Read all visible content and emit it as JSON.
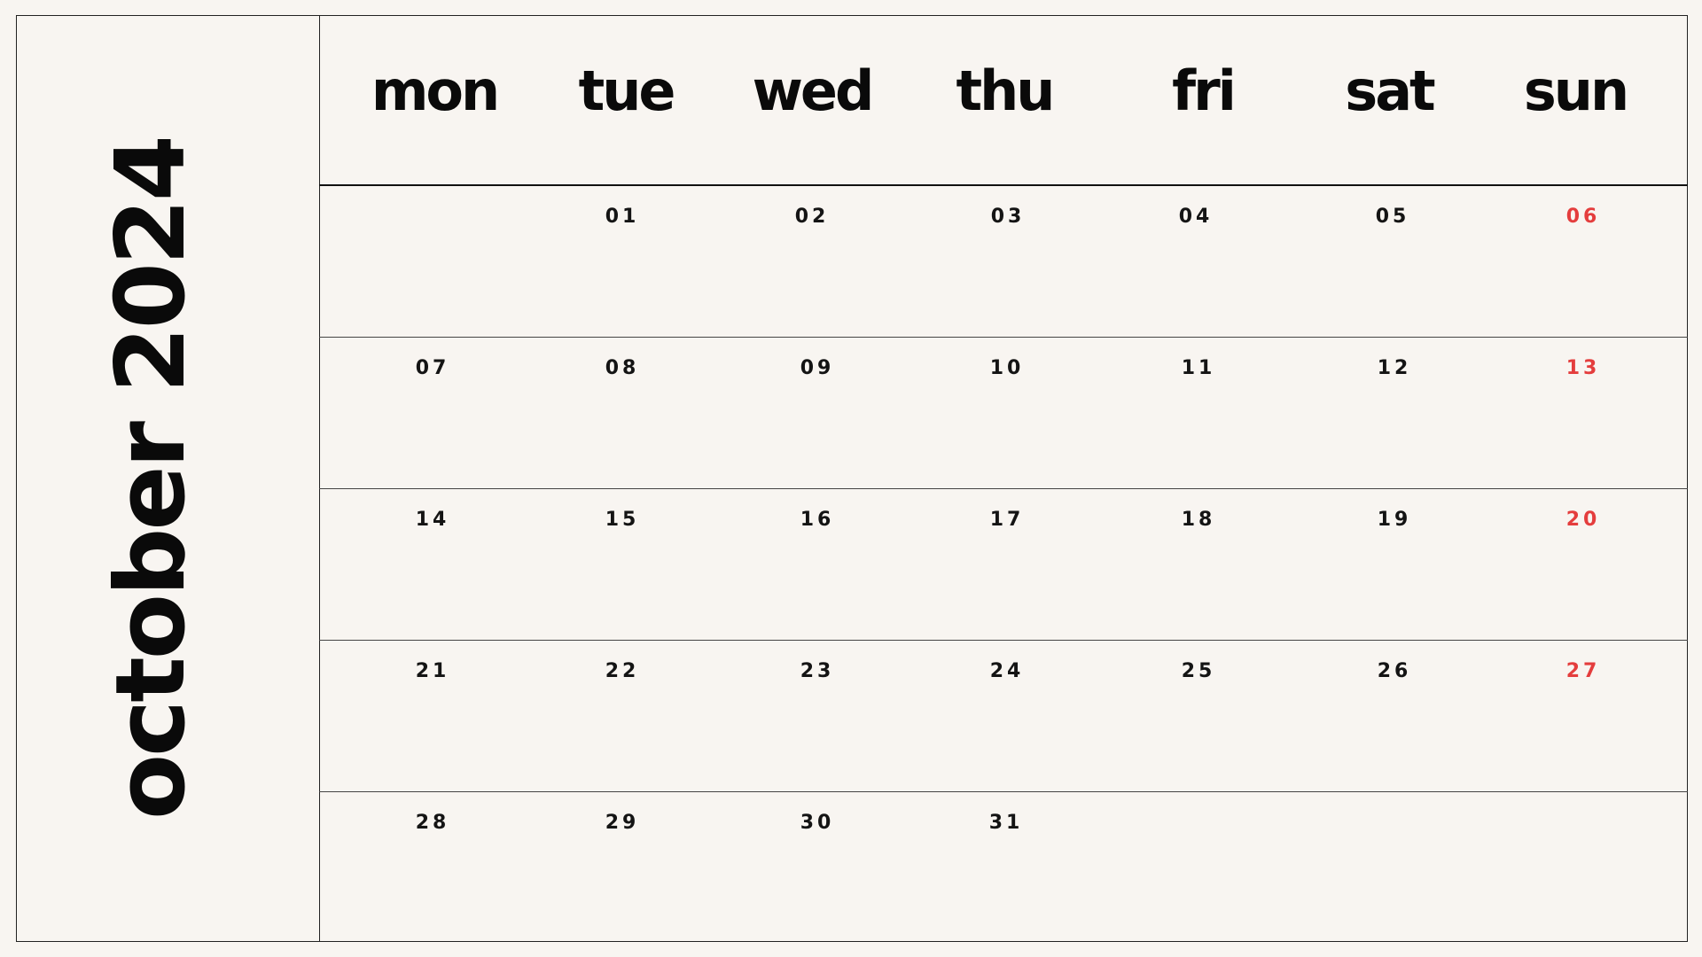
{
  "calendar": {
    "title": "october 2024",
    "weekday_headers": [
      "mon",
      "tue",
      "wed",
      "thu",
      "fri",
      "sat",
      "sun"
    ],
    "weeks": [
      [
        "",
        "01",
        "02",
        "03",
        "04",
        "05",
        "06"
      ],
      [
        "07",
        "08",
        "09",
        "10",
        "11",
        "12",
        "13"
      ],
      [
        "14",
        "15",
        "16",
        "17",
        "18",
        "19",
        "20"
      ],
      [
        "21",
        "22",
        "23",
        "24",
        "25",
        "26",
        "27"
      ],
      [
        "28",
        "29",
        "30",
        "31",
        "",
        "",
        ""
      ]
    ],
    "colors": {
      "background": "#f8f5f1",
      "text": "#0a0a0a",
      "sunday": "#e43d3d",
      "lines": "#222222"
    }
  }
}
